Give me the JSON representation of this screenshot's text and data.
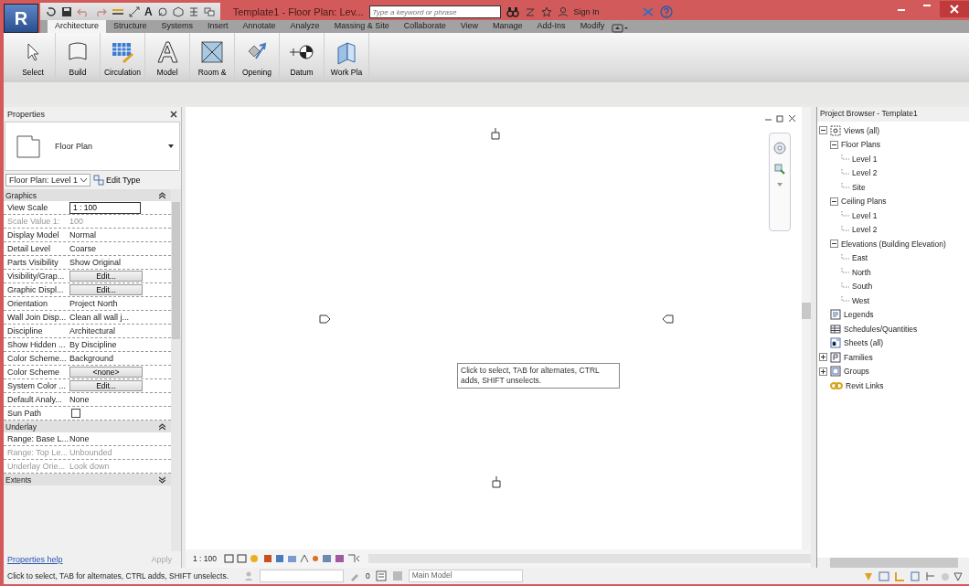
{
  "app_button": "R",
  "quick_access": {
    "text_tool": "A"
  },
  "window": {
    "title": "Template1 - Floor Plan: Lev..."
  },
  "search": {
    "placeholder": "Type a keyword or phrase"
  },
  "sign_in": "Sign In",
  "ribbon": {
    "tabs": [
      {
        "label": "Architecture",
        "selected": true
      },
      {
        "label": "Structure",
        "selected": false
      },
      {
        "label": "Systems",
        "selected": false
      },
      {
        "label": "Insert",
        "selected": false
      },
      {
        "label": "Annotate",
        "selected": false
      },
      {
        "label": "Analyze",
        "selected": false
      },
      {
        "label": "Massing & Site",
        "selected": false
      },
      {
        "label": "Collaborate",
        "selected": false
      },
      {
        "label": "View",
        "selected": false
      },
      {
        "label": "Manage",
        "selected": false
      },
      {
        "label": "Add-Ins",
        "selected": false
      },
      {
        "label": "Modify",
        "selected": false
      }
    ],
    "buttons": [
      {
        "label": "Select",
        "kind": "select"
      },
      {
        "label": "Build",
        "kind": "build"
      },
      {
        "label": "Circulation",
        "kind": "circulation"
      },
      {
        "label": "Model",
        "kind": "model"
      },
      {
        "label": "Room &",
        "kind": "room"
      },
      {
        "label": "Opening",
        "kind": "opening"
      },
      {
        "label": "Datum",
        "kind": "datum"
      },
      {
        "label": "Work Pla",
        "kind": "workplane"
      }
    ]
  },
  "properties": {
    "title": "Properties",
    "type_name": "Floor Plan",
    "selector": "Floor Plan: Level 1",
    "edit_type": "Edit Type",
    "groups": [
      {
        "name": "Graphics",
        "expanded": true,
        "rows": [
          {
            "label": "View Scale",
            "value": "1 : 100",
            "kind": "field",
            "disabled": false
          },
          {
            "label": "Scale Value 1:",
            "value": "100",
            "kind": "text",
            "disabled": true
          },
          {
            "label": "Display Model",
            "value": "Normal",
            "kind": "text",
            "disabled": false
          },
          {
            "label": "Detail Level",
            "value": "Coarse",
            "kind": "text",
            "disabled": false
          },
          {
            "label": "Parts Visibility",
            "value": "Show Original",
            "kind": "text",
            "disabled": false
          },
          {
            "label": "Visibility/Grap...",
            "value": "Edit...",
            "kind": "button",
            "disabled": false
          },
          {
            "label": "Graphic Displ...",
            "value": "Edit...",
            "kind": "button",
            "disabled": false
          },
          {
            "label": "Orientation",
            "value": "Project North",
            "kind": "text",
            "disabled": false
          },
          {
            "label": "Wall Join Disp...",
            "value": "Clean all wall j...",
            "kind": "text",
            "disabled": false
          },
          {
            "label": "Discipline",
            "value": "Architectural",
            "kind": "text",
            "disabled": false
          },
          {
            "label": "Show Hidden ...",
            "value": "By Discipline",
            "kind": "text",
            "disabled": false
          },
          {
            "label": "Color Scheme...",
            "value": "Background",
            "kind": "text",
            "disabled": false
          },
          {
            "label": "Color Scheme",
            "value": "<none>",
            "kind": "button",
            "disabled": false
          },
          {
            "label": "System Color ...",
            "value": "Edit...",
            "kind": "button",
            "disabled": false
          },
          {
            "label": "Default Analy...",
            "value": "None",
            "kind": "text",
            "disabled": false
          },
          {
            "label": "Sun Path",
            "kind": "checkbox",
            "checked": false,
            "disabled": false
          }
        ]
      },
      {
        "name": "Underlay",
        "expanded": true,
        "rows": [
          {
            "label": "Range: Base L...",
            "value": "None",
            "kind": "text",
            "disabled": false
          },
          {
            "label": "Range: Top Le...",
            "value": "Unbounded",
            "kind": "text",
            "disabled": true
          },
          {
            "label": "Underlay Orie...",
            "value": "Look down",
            "kind": "text",
            "disabled": true
          }
        ]
      },
      {
        "name": "Extents",
        "expanded": false
      }
    ],
    "help_link": "Properties help",
    "apply": {
      "label": "Apply",
      "disabled": true
    }
  },
  "canvas": {
    "tooltip": "Click to select, TAB for alternates, CTRL adds, SHIFT unselects.",
    "scale": "1 : 100"
  },
  "browser": {
    "title": "Project Browser - Template1",
    "tree": [
      {
        "label": "Views (all)",
        "kind": "views",
        "expanded": true,
        "children": [
          {
            "label": "Floor Plans",
            "expanded": true,
            "children": [
              {
                "label": "Level 1"
              },
              {
                "label": "Level 2"
              },
              {
                "label": "Site"
              }
            ]
          },
          {
            "label": "Ceiling Plans",
            "expanded": true,
            "children": [
              {
                "label": "Level 1"
              },
              {
                "label": "Level 2"
              }
            ]
          },
          {
            "label": "Elevations (Building Elevation)",
            "expanded": true,
            "children": [
              {
                "label": "East"
              },
              {
                "label": "North"
              },
              {
                "label": "South"
              },
              {
                "label": "West"
              }
            ]
          }
        ]
      },
      {
        "label": "Legends",
        "kind": "legends"
      },
      {
        "label": "Schedules/Quantities",
        "kind": "schedules"
      },
      {
        "label": "Sheets (all)",
        "kind": "sheets"
      },
      {
        "label": "Families",
        "kind": "families",
        "expanded": false
      },
      {
        "label": "Groups",
        "kind": "groups",
        "expanded": false
      },
      {
        "label": "Revit Links",
        "kind": "links"
      }
    ]
  },
  "status_bar": {
    "message": "Click to select, TAB for alternates, CTRL adds, SHIFT unselects.",
    "field_value": "0",
    "model": "Main Model"
  }
}
